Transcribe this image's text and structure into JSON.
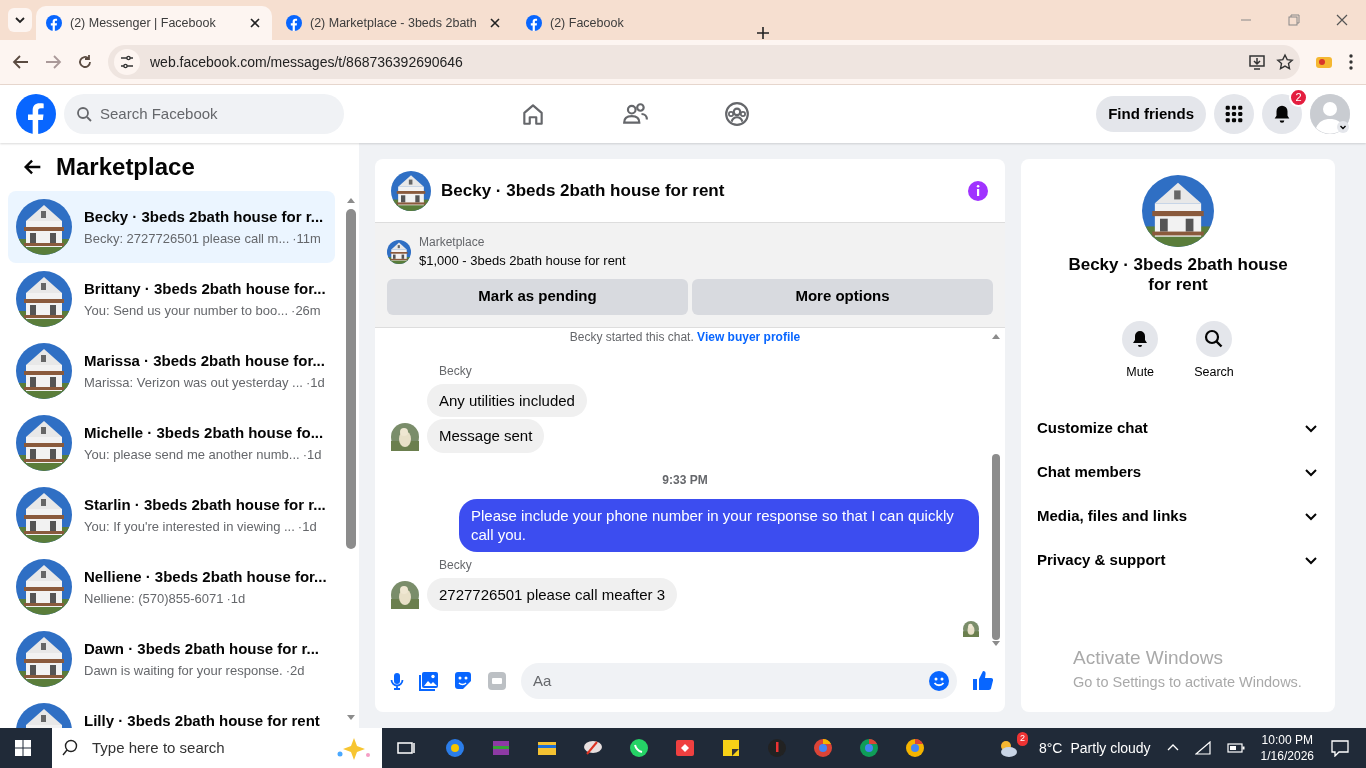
{
  "browser": {
    "tabs": [
      {
        "title": "(2) Messenger | Facebook",
        "selected": true
      },
      {
        "title": "(2) Marketplace - 3beds 2bath",
        "selected": false
      },
      {
        "title": "(2) Facebook",
        "selected": false
      }
    ],
    "url": "web.facebook.com/messages/t/868736392690646"
  },
  "header": {
    "search_placeholder": "Search Facebook",
    "find_friends": "Find friends",
    "notification_count": "2"
  },
  "sidebar": {
    "title": "Marketplace",
    "chats": [
      {
        "name": "Becky · 3beds 2bath house for r...",
        "preview": "Becky: 2727726501 please call m...",
        "time": "·11m",
        "selected": true
      },
      {
        "name": "Brittany · 3beds 2bath house for...",
        "preview": "You: Send us your number to boo...",
        "time": "·26m",
        "selected": false
      },
      {
        "name": "Marissa · 3beds 2bath house for...",
        "preview": "Marissa: Verizon was out yesterday ...",
        "time": "·1d",
        "selected": false
      },
      {
        "name": "Michelle · 3beds 2bath house fo...",
        "preview": "You: please send me another numb...",
        "time": "·1d",
        "selected": false
      },
      {
        "name": "Starlin · 3beds 2bath house for r...",
        "preview": "You: If you're interested in viewing ...",
        "time": "·1d",
        "selected": false
      },
      {
        "name": "Nelliene · 3beds 2bath house for...",
        "preview": "Nelliene: (570)855-6071",
        "time": "·1d",
        "selected": false
      },
      {
        "name": "Dawn · 3beds 2bath house for r...",
        "preview": "Dawn is waiting for your response.",
        "time": "·2d",
        "selected": false
      },
      {
        "name": "Lilly · 3beds 2bath house for rent",
        "selected": false
      }
    ]
  },
  "chat": {
    "title": "Becky · 3beds 2bath house for rent",
    "listing": {
      "label": "Marketplace",
      "title": "$1,000 - 3beds 2bath house for rent",
      "buttons": [
        "Mark as pending",
        "More options"
      ]
    },
    "notice": {
      "text": "Becky started this chat.",
      "link": "View buyer profile"
    },
    "messages": [
      {
        "kind": "sender",
        "text": "Becky"
      },
      {
        "kind": "incoming",
        "text": "Any utilities included",
        "avatar": false
      },
      {
        "kind": "incoming",
        "text": "Message sent",
        "avatar": true
      },
      {
        "kind": "timestamp",
        "text": "9:33 PM"
      },
      {
        "kind": "outgoing",
        "text": "Please include your phone number in your response so that I can quickly call you."
      },
      {
        "kind": "sender",
        "text": "Becky"
      },
      {
        "kind": "incoming",
        "text": "2727726501 please call meafter 3",
        "avatar": true
      }
    ],
    "composer_placeholder": "Aa"
  },
  "details": {
    "name": "Becky · 3beds 2bath house for rent",
    "actions": [
      {
        "kind": "mute",
        "label": "Mute"
      },
      {
        "kind": "search",
        "label": "Search"
      }
    ],
    "sections": [
      "Customize chat",
      "Chat members",
      "Media, files and links",
      "Privacy & support"
    ]
  },
  "activation": {
    "title": "Activate Windows",
    "text": "Go to Settings to activate Windows."
  },
  "taskbar": {
    "search_placeholder": "Type here to search",
    "weather_badge": "2",
    "temperature": "8°C",
    "weather": "Partly cloudy",
    "time": "10:00 PM",
    "date": "1/16/2026"
  }
}
